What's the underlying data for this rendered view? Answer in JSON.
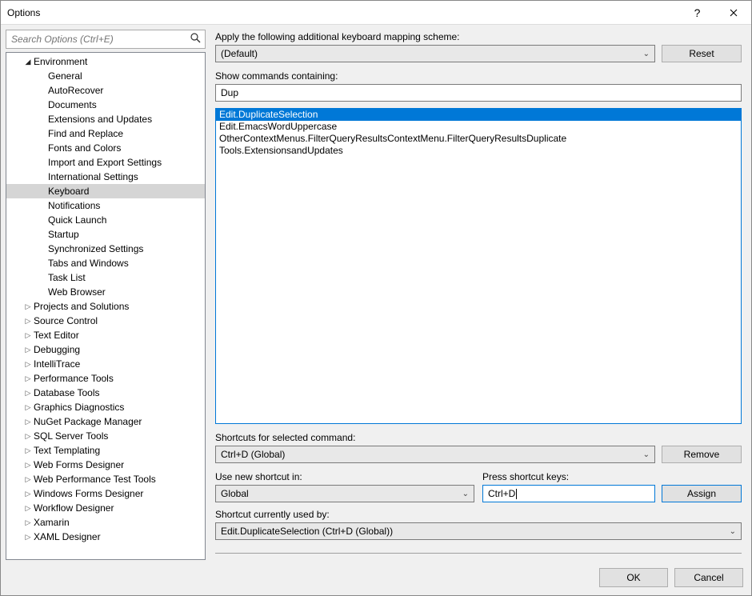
{
  "title": "Options",
  "search_placeholder": "Search Options (Ctrl+E)",
  "tree": {
    "env": "Environment",
    "env_children": [
      "General",
      "AutoRecover",
      "Documents",
      "Extensions and Updates",
      "Find and Replace",
      "Fonts and Colors",
      "Import and Export Settings",
      "International Settings",
      "Keyboard",
      "Notifications",
      "Quick Launch",
      "Startup",
      "Synchronized Settings",
      "Tabs and Windows",
      "Task List",
      "Web Browser"
    ],
    "selected_child": "Keyboard",
    "roots": [
      "Projects and Solutions",
      "Source Control",
      "Text Editor",
      "Debugging",
      "IntelliTrace",
      "Performance Tools",
      "Database Tools",
      "Graphics Diagnostics",
      "NuGet Package Manager",
      "SQL Server Tools",
      "Text Templating",
      "Web Forms Designer",
      "Web Performance Test Tools",
      "Windows Forms Designer",
      "Workflow Designer",
      "Xamarin",
      "XAML Designer"
    ]
  },
  "labels": {
    "apply_scheme": "Apply the following additional keyboard mapping scheme:",
    "show_commands": "Show commands containing:",
    "shortcuts_for": "Shortcuts for selected command:",
    "use_new": "Use new shortcut in:",
    "press_keys": "Press shortcut keys:",
    "currently_used": "Shortcut currently used by:"
  },
  "values": {
    "scheme": "(Default)",
    "filter_text": "Dup",
    "selected_shortcut": "Ctrl+D (Global)",
    "scope": "Global",
    "pressed_keys": "Ctrl+D",
    "used_by": "Edit.DuplicateSelection (Ctrl+D (Global))"
  },
  "commands": [
    "Edit.DuplicateSelection",
    "Edit.EmacsWordUppercase",
    "OtherContextMenus.FilterQueryResultsContextMenu.FilterQueryResultsDuplicate",
    "Tools.ExtensionsandUpdates"
  ],
  "buttons": {
    "reset": "Reset",
    "remove": "Remove",
    "assign": "Assign",
    "ok": "OK",
    "cancel": "Cancel"
  }
}
